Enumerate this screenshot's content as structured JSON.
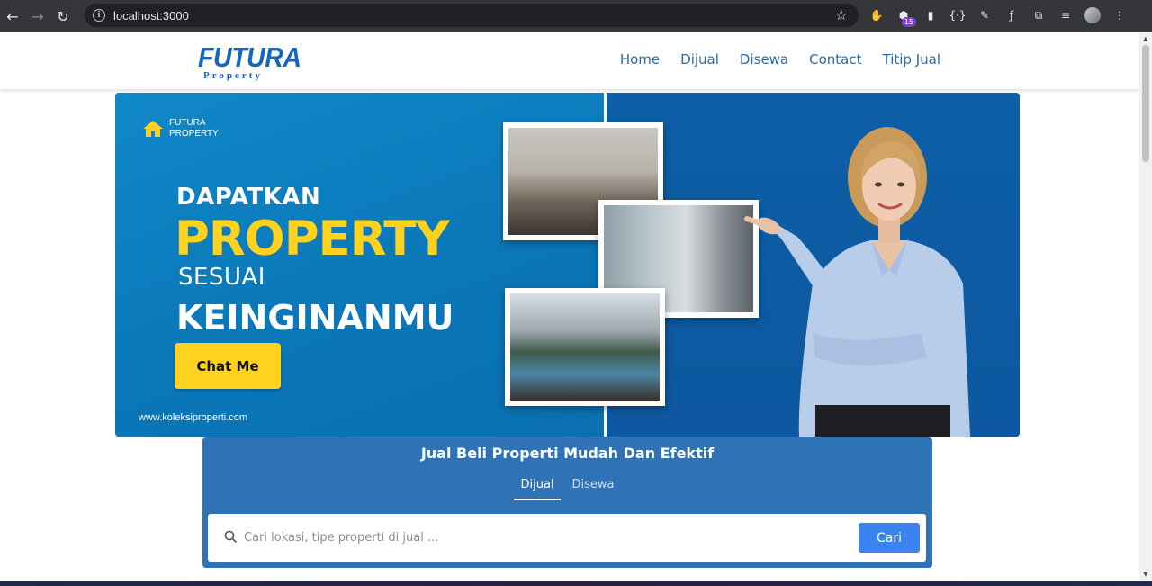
{
  "browser": {
    "url": "localhost:3000",
    "back_icon": "back-arrow-icon",
    "forward_icon": "forward-arrow-icon",
    "reload_icon": "reload-icon",
    "extension_badge": "15"
  },
  "navbar": {
    "logo_main": "FUTURA",
    "logo_sub": "Property",
    "menu": [
      {
        "label": "Home"
      },
      {
        "label": "Dijual"
      },
      {
        "label": "Disewa"
      },
      {
        "label": "Contact"
      },
      {
        "label": "Titip Jual"
      }
    ]
  },
  "hero": {
    "brand_line1": "FUTURA",
    "brand_line2": "PROPERTY",
    "line1": "DAPATKAN",
    "line2": "PROPERTY",
    "line3": "SESUAI",
    "line4": "KEINGINANMU",
    "cta": "Chat Me",
    "website": "www.koleksiproperti.com",
    "colors": {
      "bg_left": "#0a78b9",
      "bg_right": "#0d5fa6",
      "accent": "#ffd21f"
    }
  },
  "search": {
    "title": "Jual Beli Properti Mudah Dan Efektif",
    "tabs": [
      {
        "label": "Dijual",
        "active": true
      },
      {
        "label": "Disewa",
        "active": false
      }
    ],
    "placeholder": "Cari lokasi, tipe properti di jual ...",
    "button": "Cari",
    "colors": {
      "panel": "#2f72b5",
      "button": "#3b84f0"
    }
  }
}
